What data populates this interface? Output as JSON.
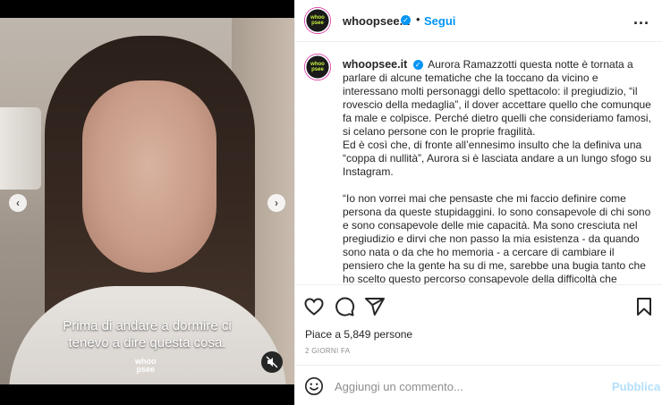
{
  "post": {
    "username": "whoopsee.it",
    "follow_label": "Segui",
    "dot": "•",
    "more_label": "...",
    "avatar_text_1": "whoo",
    "avatar_text_2": "psee"
  },
  "media": {
    "caption_line_1": "Prima di andare a dormire ci",
    "caption_line_2": "tenevo a dire questa cosa.",
    "watermark_1": "whoo",
    "watermark_2": "psee",
    "nav_left": "‹",
    "nav_right": "›"
  },
  "comment": {
    "username": "whoopsee.it",
    "paragraph_1": "Aurora Ramazzotti questa notte è tornata a parlare di alcune tematiche che la toccano da vicino e interessano molti personaggi dello spettacolo: il pregiudizio, “il rovescio della medaglia”, il dover accettare quello che comunque fa male e colpisce. Perché dietro quelli che consideriamo famosi, si celano persone con le proprie fragilità.",
    "paragraph_2": "Ed è così che, di fronte all’ennesimo insulto che la definiva una “coppa di nullità”, Aurora si è lasciata andare a un lungo sfogo su Instagram.",
    "paragraph_3": "“Io non vorrei mai che pensaste che mi faccio definire come persona da queste stupidaggini. Io sono consapevole di chi sono e sono consapevole delle mie capacità. Ma sono cresciuta nel pregiudizio e dirvi che non passo la mia esistenza - da quando sono nata o da che ho memoria - a cercare di cambiare il pensiero che la gente ha su di me, sarebbe una bugia tanto che ho scelto questo percorso consapevole della difficoltà che"
  },
  "actions": {
    "likes_label": "Piace a 5,849 persone",
    "time_label": "2 GIORNI FA"
  },
  "add_comment": {
    "placeholder": "Aggiungi un commento...",
    "publish_label": "Pubblica"
  },
  "colors": {
    "accent": "#0095f6",
    "publish_disabled": "#b2dffc",
    "brand_green": "#c8f03c"
  },
  "icons": [
    "verified-badge-icon",
    "more-options-icon",
    "chevron-left-icon",
    "chevron-right-icon",
    "mute-icon",
    "heart-icon",
    "comment-icon",
    "share-icon",
    "bookmark-icon",
    "emoji-icon"
  ]
}
